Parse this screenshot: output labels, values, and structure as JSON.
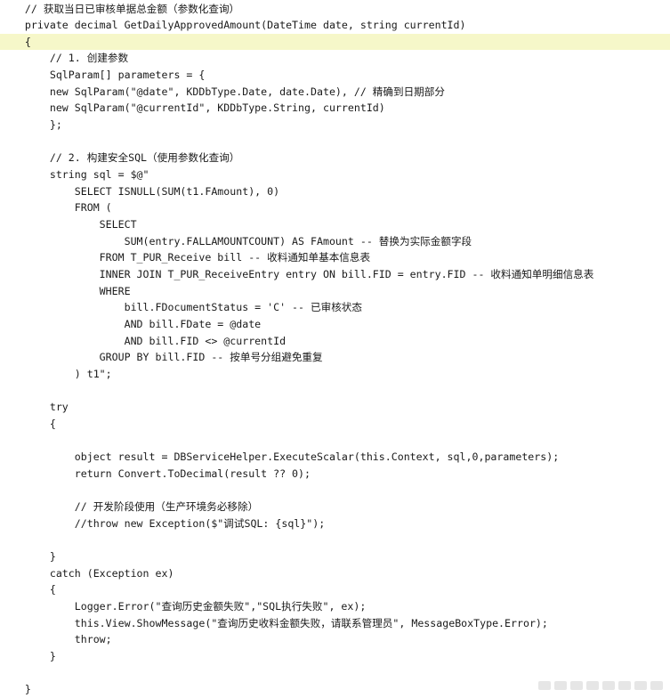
{
  "code_lines": [
    {
      "text": "    // 获取当日已审核单据总金额（参数化查询）"
    },
    {
      "text": "    private decimal GetDailyApprovedAmount(DateTime date, string currentId)"
    },
    {
      "text": "    {"
    },
    {
      "text": "        // 1. 创建参数"
    },
    {
      "text": "        SqlParam[] parameters = {"
    },
    {
      "text": "        new SqlParam(\"@date\", KDDbType.Date, date.Date), // 精确到日期部分"
    },
    {
      "text": "        new SqlParam(\"@currentId\", KDDbType.String, currentId)"
    },
    {
      "text": "        };"
    },
    {
      "text": ""
    },
    {
      "text": "        // 2. 构建安全SQL（使用参数化查询）"
    },
    {
      "text": "        string sql = $@\""
    },
    {
      "text": "            SELECT ISNULL(SUM(t1.FAmount), 0)"
    },
    {
      "text": "            FROM ("
    },
    {
      "text": "                SELECT"
    },
    {
      "text": "                    SUM(entry.FALLAMOUNTCOUNT) AS FAmount -- 替换为实际金额字段"
    },
    {
      "text": "                FROM T_PUR_Receive bill -- 收料通知单基本信息表"
    },
    {
      "text": "                INNER JOIN T_PUR_ReceiveEntry entry ON bill.FID = entry.FID -- 收料通知单明细信息表"
    },
    {
      "text": "                WHERE"
    },
    {
      "text": "                    bill.FDocumentStatus = 'C' -- 已审核状态"
    },
    {
      "text": "                    AND bill.FDate = @date"
    },
    {
      "text": "                    AND bill.FID <> @currentId"
    },
    {
      "text": "                GROUP BY bill.FID -- 按单号分组避免重复"
    },
    {
      "text": "            ) t1\";"
    },
    {
      "text": ""
    },
    {
      "text": "        try"
    },
    {
      "text": "        {"
    },
    {
      "text": ""
    },
    {
      "text": "            object result = DBServiceHelper.ExecuteScalar(this.Context, sql,0,parameters);"
    },
    {
      "text": "            return Convert.ToDecimal(result ?? 0);"
    },
    {
      "text": ""
    },
    {
      "text": "            // 开发阶段使用（生产环境务必移除）"
    },
    {
      "text": "            //throw new Exception($\"调试SQL: {sql}\");"
    },
    {
      "text": ""
    },
    {
      "text": "        }"
    },
    {
      "text": "        catch (Exception ex)"
    },
    {
      "text": "        {"
    },
    {
      "text": "            Logger.Error(\"查询历史金额失败\",\"SQL执行失败\", ex);"
    },
    {
      "text": "            this.View.ShowMessage(\"查询历史收料金额失败，请联系管理员\", MessageBoxType.Error);"
    },
    {
      "text": "            throw;"
    },
    {
      "text": "        }"
    },
    {
      "text": ""
    },
    {
      "text": "    }"
    }
  ],
  "colors": {
    "keyword": "#0000ff",
    "type": "#2b91af",
    "comment": "#008000",
    "string": "#a31515",
    "number": "#e0007a",
    "current_line": "#f6f7c9"
  }
}
